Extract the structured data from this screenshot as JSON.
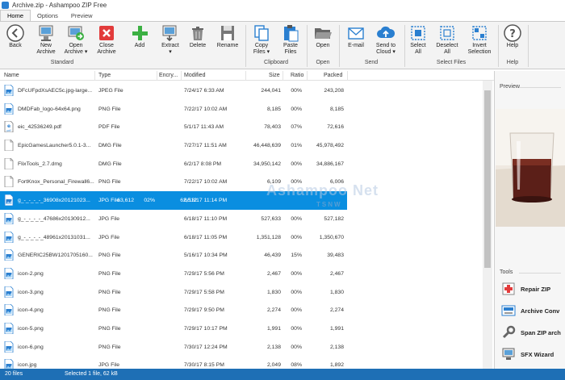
{
  "window": {
    "title": "Archive.zip - Ashampoo ZIP Free"
  },
  "tabs": [
    {
      "label": "Home",
      "active": true
    },
    {
      "label": "Options",
      "active": false
    },
    {
      "label": "Preview",
      "active": false
    }
  ],
  "ribbon": {
    "buttons": {
      "back": "Back",
      "new_archive": "New\nArchive",
      "open_archive": "Open\nArchive ▾",
      "close_archive": "Close\nArchive",
      "add": "Add",
      "extract": "Extract\n▾",
      "delete": "Delete",
      "rename": "Rename",
      "copy_files": "Copy\nFiles ▾",
      "paste_files": "Paste\nFiles",
      "open": "Open",
      "email": "E-mail",
      "send_to_cloud": "Send to\nCloud ▾",
      "select_all": "Select\nAll",
      "deselect_all": "Deselect\nAll",
      "invert_selection": "Invert\nSelection",
      "help": "Help"
    },
    "groups": {
      "standard": "Standard",
      "clipboard": "Clipboard",
      "open": "Open",
      "send": "Send",
      "select_files": "Select Files",
      "help": "Help"
    }
  },
  "columns": {
    "name": "Name",
    "type": "Type",
    "encrypted": "Encry...",
    "modified": "Modified",
    "size": "Size",
    "ratio": "Ratio",
    "packed": "Packed"
  },
  "files": [
    {
      "name": "DFcUFpdXsAEC5c.jpg-large...",
      "type": "JPEG File",
      "modified": "7/24/17 6:33 AM",
      "size": "244,041",
      "ratio": "00%",
      "packed": "243,208",
      "icon": "image-file-icon",
      "selected": false
    },
    {
      "name": "DMDFab_logo-64x64.png",
      "type": "PNG File",
      "modified": "7/22/17 10:02 AM",
      "size": "8,185",
      "ratio": "00%",
      "packed": "8,185",
      "icon": "image-file-icon",
      "selected": false
    },
    {
      "name": "eic_42536249.pdf",
      "type": "PDF File",
      "modified": "5/1/17 11:43 AM",
      "size": "78,403",
      "ratio": "07%",
      "packed": "72,616",
      "icon": "pdf-file-icon",
      "selected": false
    },
    {
      "name": "EpicGamesLauncher5.0.1-3...",
      "type": "DMG File",
      "modified": "7/27/17 11:51 AM",
      "size": "46,448,639",
      "ratio": "01%",
      "packed": "45,978,492",
      "icon": "generic-file-icon",
      "selected": false
    },
    {
      "name": "FlixTools_2.7.dmg",
      "type": "DMG File",
      "modified": "6/2/17 8:08 PM",
      "size": "34,950,142",
      "ratio": "00%",
      "packed": "34,886,167",
      "icon": "generic-file-icon",
      "selected": false
    },
    {
      "name": "FortKnox_Personal_Firewall6...",
      "type": "PNG File",
      "modified": "7/22/17 10:02 AM",
      "size": "6,109",
      "ratio": "00%",
      "packed": "6,006",
      "icon": "generic-file-icon",
      "selected": false
    },
    {
      "name": "g_-_-_-_-_36908x20121023...",
      "type": "JPG File",
      "modified": "6/18/17 11:14 PM",
      "size": "63,612",
      "ratio": "02%",
      "packed": "62,512",
      "icon": "image-file-icon",
      "selected": true
    },
    {
      "name": "g_-_-_-_-_47686x20130912...",
      "type": "JPG File",
      "modified": "6/18/17 11:10 PM",
      "size": "527,633",
      "ratio": "00%",
      "packed": "527,182",
      "icon": "image-file-icon",
      "selected": false
    },
    {
      "name": "g_-_-_-_-_48961x20131031...",
      "type": "JPG File",
      "modified": "6/18/17 11:05 PM",
      "size": "1,351,128",
      "ratio": "00%",
      "packed": "1,350,670",
      "icon": "image-file-icon",
      "selected": false
    },
    {
      "name": "GENERIC25BW1201705160...",
      "type": "PNG File",
      "modified": "5/16/17 10:34 PM",
      "size": "46,439",
      "ratio": "15%",
      "packed": "39,483",
      "icon": "image-file-icon",
      "selected": false
    },
    {
      "name": "icon-2.png",
      "type": "PNG File",
      "modified": "7/29/17 5:56 PM",
      "size": "2,467",
      "ratio": "00%",
      "packed": "2,467",
      "icon": "image-file-icon",
      "selected": false
    },
    {
      "name": "icon-3.png",
      "type": "PNG File",
      "modified": "7/29/17 5:58 PM",
      "size": "1,830",
      "ratio": "00%",
      "packed": "1,830",
      "icon": "image-file-icon",
      "selected": false
    },
    {
      "name": "icon-4.png",
      "type": "PNG File",
      "modified": "7/29/17 9:50 PM",
      "size": "2,274",
      "ratio": "00%",
      "packed": "2,274",
      "icon": "image-file-icon",
      "selected": false
    },
    {
      "name": "icon-5.png",
      "type": "PNG File",
      "modified": "7/29/17 10:17 PM",
      "size": "1,991",
      "ratio": "00%",
      "packed": "1,991",
      "icon": "image-file-icon",
      "selected": false
    },
    {
      "name": "icon-6.png",
      "type": "PNG File",
      "modified": "7/30/17 12:24 PM",
      "size": "2,138",
      "ratio": "00%",
      "packed": "2,138",
      "icon": "image-file-icon",
      "selected": false
    },
    {
      "name": "icon.jpg",
      "type": "JPG File",
      "modified": "7/30/17 8:15 PM",
      "size": "2,049",
      "ratio": "08%",
      "packed": "1,892",
      "icon": "image-file-icon",
      "selected": false
    }
  ],
  "side_panel": {
    "preview_label": "Preview",
    "tools_label": "Tools",
    "tools": [
      {
        "label": "Repair ZIP",
        "icon": "repair-zip-icon"
      },
      {
        "label": "Archive Conv",
        "icon": "archive-convert-icon"
      },
      {
        "label": "Span ZIP arch",
        "icon": "wrench-icon"
      },
      {
        "label": "SFX Wizard",
        "icon": "sfx-wizard-icon"
      }
    ]
  },
  "status": {
    "file_count": "20 files",
    "selection": "Selected 1 file, 62 kB"
  },
  "colors": {
    "accent": "#0a8ee0",
    "status_bar": "#1e6fb5",
    "ribbon_bg": "#f3f3f3"
  }
}
